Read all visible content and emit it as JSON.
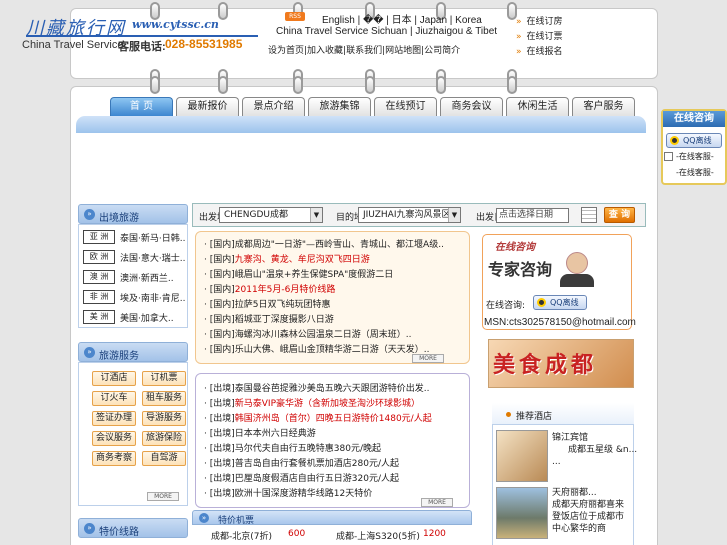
{
  "header": {
    "logo_cn": "川藏旅行网",
    "logo_url": "www.cytssc.cn",
    "logo_en": "China Travel Service",
    "hotline_label": "客服电话:",
    "hotline_number": "028-85531985",
    "rss_label": "RSS",
    "lang_links": "English | �� | 日本 | Japan | Korea",
    "slogan": "China Travel Service Sichuan | Jiuzhaigou & Tibet",
    "header_links": "设为首页|加入收藏|联系我们|网站地图|公司简介",
    "quick_links": [
      "在线订房",
      "在线订票",
      "在线报名"
    ]
  },
  "nav": {
    "tabs": [
      "首 页",
      "最新报价",
      "景点介绍",
      "旅游集锦",
      "在线预订",
      "商务会议",
      "休闲生活",
      "客户服务"
    ]
  },
  "sidebar": {
    "section1_title": "出境旅游",
    "continents": [
      {
        "label": "亚 洲",
        "text": "泰国·新马·日韩.."
      },
      {
        "label": "欧 洲",
        "text": "法国·意大·瑞士.."
      },
      {
        "label": "澳 洲",
        "text": "澳洲·新西兰.."
      },
      {
        "label": "非 洲",
        "text": "埃及·南非·肯尼.."
      },
      {
        "label": "美 洲",
        "text": "美国·加拿大.."
      }
    ],
    "section2_title": "旅游服务",
    "services": [
      "订酒店",
      "订机票",
      "订火车",
      "租车服务",
      "签证办理",
      "导游服务",
      "会议服务",
      "旅游保险",
      "商务考察",
      "自驾游"
    ],
    "more_label": "MORE",
    "section3_title": "特价线路"
  },
  "search": {
    "from_label": "出发地",
    "from_value": "CHENGDU成都",
    "to_label": "目的地",
    "to_value": "JIUZHAI九寨沟风景区",
    "date_label": "出发日",
    "date_value": "点击选择日期",
    "button": "查 询"
  },
  "news1": [
    {
      "tag": "[国内]",
      "text": "成都周边\"一日游\"—西岭雪山、青城山、都江堰A级..",
      "red": false
    },
    {
      "tag": "[国内]",
      "text": "九寨沟、黄龙、牟尼沟双飞四日游",
      "red": true
    },
    {
      "tag": "[国内]",
      "text": "峨眉山\"温泉+养生保健SPA\"度假游二日",
      "red": false
    },
    {
      "tag": "[国内]",
      "text": "2011年5月-6月特价线路",
      "red": true
    },
    {
      "tag": "[国内]",
      "text": "拉萨5日双飞纯玩团特惠",
      "red": false
    },
    {
      "tag": "[国内]",
      "text": "稻城亚丁深度摄影八日游",
      "red": false
    },
    {
      "tag": "[国内]",
      "text": "海螺沟冰川森林公园温泉二日游（周末班）..",
      "red": false
    },
    {
      "tag": "[国内]",
      "text": "乐山大佛、峨眉山金顶精华游二日游（天天发）..",
      "red": false
    }
  ],
  "news2": [
    {
      "tag": "[出境]",
      "text": "泰国曼谷芭提雅沙美岛五晚六天跟团游特价出发..",
      "red": false
    },
    {
      "tag": "[出境]",
      "text": "新马泰VIP豪华游（含新加坡圣淘沙环球影城）",
      "red": true
    },
    {
      "tag": "[出境]",
      "text": "韩国济州岛（首尔）四晚五日游特价1480元/人起",
      "red": true
    },
    {
      "tag": "[出境]",
      "text": "日本本州六日经典游",
      "red": false
    },
    {
      "tag": "[出境]",
      "text": "马尔代夫自由行五晚特惠380元/晚起",
      "red": false
    },
    {
      "tag": "[出境]",
      "text": "普吉岛自由行套餐机票加酒店280元/人起",
      "red": false
    },
    {
      "tag": "[出境]",
      "text": "巴厘岛度假酒店自由行五日游320元/人起",
      "red": false
    },
    {
      "tag": "[出境]",
      "text": "欧洲十国深度游精华线路12天特价",
      "red": false
    }
  ],
  "consult": {
    "title": "在线咨询",
    "expert_label": "专家咨询",
    "online_label": "在线咨询:",
    "qq_label": "QQ离线",
    "msn": "MSN:cts302578150@hotmail.com"
  },
  "food_banner": "美食成都",
  "hotels": {
    "title": "推荐酒店",
    "items": [
      {
        "name": "锦江宾馆",
        "desc": "成都五星级 &n...",
        "more": "..."
      },
      {
        "name": "天府丽都...",
        "desc": "成都天府丽都喜来登饭店位于成都市中心繁华的商业……"
      }
    ]
  },
  "price": {
    "title": "特价机票",
    "cells": [
      "成都-北京(7折)",
      "600",
      "成都-上海S320(5折)",
      "1200"
    ]
  },
  "float_consult": {
    "title": "在线咨询",
    "qq_label": "QQ离线",
    "items": [
      "-在线客服-",
      "-在线客服-"
    ]
  },
  "colors": {
    "accent": "#3d86d0",
    "orange": "#e07a00",
    "red": "#d00000"
  }
}
